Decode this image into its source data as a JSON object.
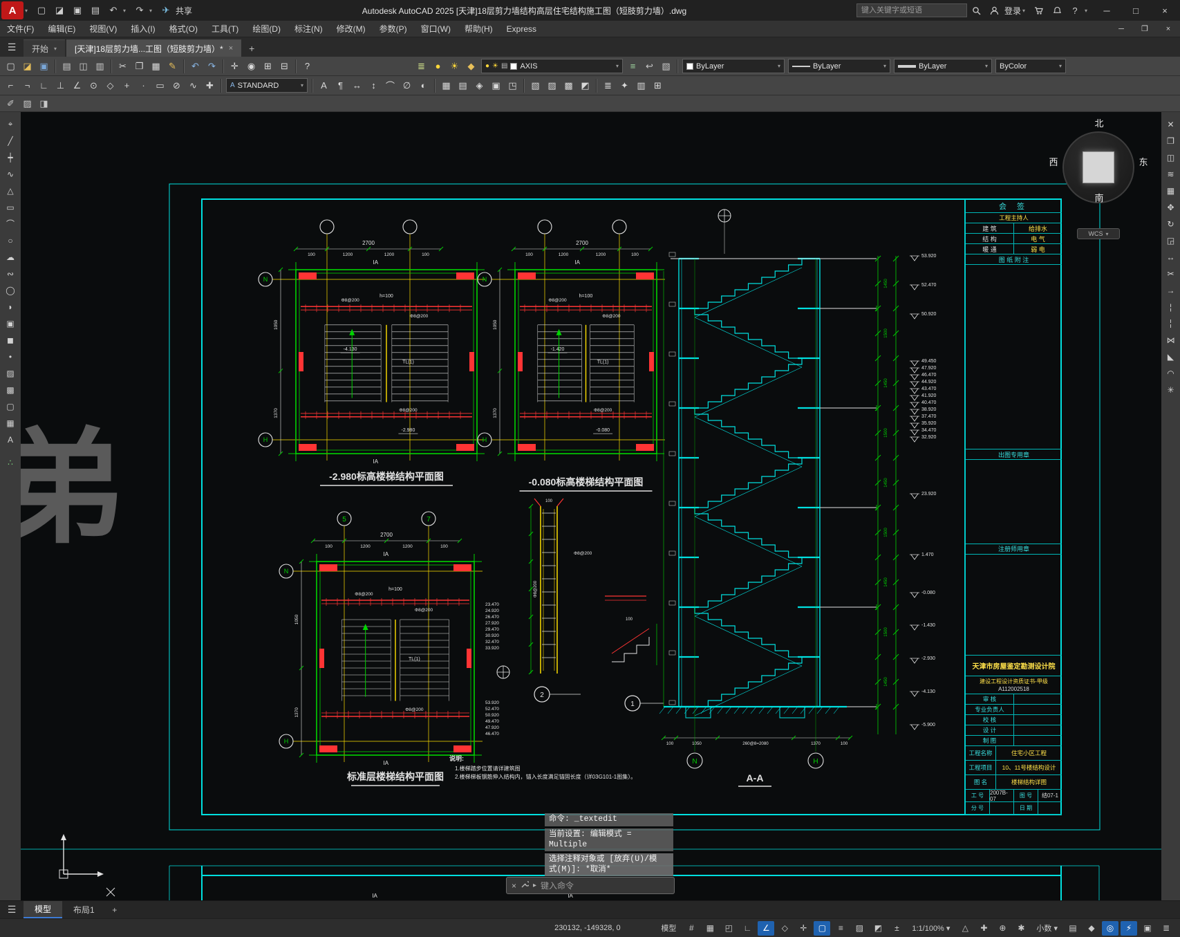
{
  "titlebar": {
    "app_logo": "A",
    "share": "共享",
    "title": "Autodesk AutoCAD 2025   [天津]18层剪力墙结构高层住宅结构施工图（短肢剪力墙）.dwg",
    "search_placeholder": "键入关键字或短语",
    "signin": "登录"
  },
  "menubar": {
    "items": [
      "文件(F)",
      "编辑(E)",
      "视图(V)",
      "插入(I)",
      "格式(O)",
      "工具(T)",
      "绘图(D)",
      "标注(N)",
      "修改(M)",
      "参数(P)",
      "窗口(W)",
      "帮助(H)",
      "Express"
    ]
  },
  "tabs": {
    "start": "开始",
    "document": "[天津]18层剪力墙...工图（短肢剪力墙）*"
  },
  "toolbar": {
    "layer_combo": "AXIS",
    "color_combo": "ByLayer",
    "linetype_combo": "ByLayer",
    "lineweight_combo": "ByLayer",
    "plotstyle_combo": "ByColor",
    "style_combo": "STANDARD",
    "row1": [
      {
        "n": "new-file",
        "g": "▢",
        "c": "#d9d9d9"
      },
      {
        "n": "open-file",
        "g": "◪",
        "c": "#e8c05a"
      },
      {
        "n": "save-file",
        "g": "▣",
        "c": "#7aa7d8"
      },
      {
        "n": "sep"
      },
      {
        "n": "plot",
        "g": "▤",
        "c": "#c9c9c9"
      },
      {
        "n": "plot-preview",
        "g": "◫",
        "c": "#c9c9c9"
      },
      {
        "n": "publish",
        "g": "▥",
        "c": "#c9c9c9"
      },
      {
        "n": "sep"
      },
      {
        "n": "cut-clip",
        "g": "✂",
        "c": "#d9d9d9"
      },
      {
        "n": "copy-clip",
        "g": "❐",
        "c": "#d9d9d9"
      },
      {
        "n": "paste-clip",
        "g": "▦",
        "c": "#d9d9d9"
      },
      {
        "n": "match-properties",
        "g": "✎",
        "c": "#e8c05a"
      },
      {
        "n": "sep"
      },
      {
        "n": "undo",
        "g": "↶",
        "c": "#8ab8e8"
      },
      {
        "n": "redo",
        "g": "↷",
        "c": "#8ab8e8"
      },
      {
        "n": "sep"
      },
      {
        "n": "pan",
        "g": "✛",
        "c": "#d9d9d9"
      },
      {
        "n": "zoom-realtime",
        "g": "◉",
        "c": "#d9d9d9"
      },
      {
        "n": "zoom-window",
        "g": "⊞",
        "c": "#d9d9d9"
      },
      {
        "n": "zoom-previous",
        "g": "⊟",
        "c": "#d9d9d9"
      },
      {
        "n": "sep"
      },
      {
        "n": "help",
        "g": "?",
        "c": "#d9d9d9"
      },
      {
        "n": "gap",
        "w": 140
      },
      {
        "n": "layer-properties",
        "g": "≣",
        "c": "#cfe08a"
      },
      {
        "n": "layer-on-off",
        "g": "●",
        "c": "#ffd83a"
      },
      {
        "n": "layer-freeze",
        "g": "☀",
        "c": "#ffd83a"
      },
      {
        "n": "layer-lock",
        "g": "◆",
        "c": "#e8c05a"
      },
      {
        "n": "combo-layer"
      },
      {
        "n": "make-current-layer",
        "g": "≡",
        "c": "#9fd49f"
      },
      {
        "n": "layer-previous",
        "g": "↩",
        "c": "#c9c9c9"
      },
      {
        "n": "layer-states",
        "g": "▧",
        "c": "#c9c9c9"
      },
      {
        "n": "sep"
      },
      {
        "n": "combo-color"
      },
      {
        "n": "combo-linetype"
      },
      {
        "n": "combo-lineweight"
      },
      {
        "n": "combo-plotstyle"
      }
    ],
    "row2": [
      {
        "n": "snap-from",
        "g": "⌐",
        "c": "#d2d2d2"
      },
      {
        "n": "snap-endpoint",
        "g": "¬",
        "c": "#d2d2d2"
      },
      {
        "n": "snap-midpoint",
        "g": "∟",
        "c": "#d2d2d2"
      },
      {
        "n": "snap-perpendicular",
        "g": "⊥",
        "c": "#d2d2d2"
      },
      {
        "n": "snap-intersection",
        "g": "∠",
        "c": "#d2d2d2"
      },
      {
        "n": "snap-center",
        "g": "⊙",
        "c": "#d2d2d2"
      },
      {
        "n": "snap-quadrant",
        "g": "◇",
        "c": "#d2d2d2"
      },
      {
        "n": "snap-node",
        "g": "+",
        "c": "#d2d2d2"
      },
      {
        "n": "snap-nearest",
        "g": "·",
        "c": "#d2d2d2"
      },
      {
        "n": "snap-extension",
        "g": "▭",
        "c": "#d2d2d2"
      },
      {
        "n": "snap-none",
        "g": "⊘",
        "c": "#d2d2d2"
      },
      {
        "n": "snap-tangent",
        "g": "∿",
        "c": "#d2d2d2"
      },
      {
        "n": "snap-parallel",
        "g": "✚",
        "c": "#d2d2d2"
      },
      {
        "n": "sep"
      },
      {
        "n": "combo-style"
      },
      {
        "n": "sep"
      },
      {
        "n": "multiline-text",
        "g": "A",
        "c": "#d9d9d9"
      },
      {
        "n": "single-line-text",
        "g": "¶",
        "c": "#d9d9d9"
      },
      {
        "n": "dim-linear",
        "g": "↔",
        "c": "#d9d9d9"
      },
      {
        "n": "dim-aligned",
        "g": "↕",
        "c": "#d9d9d9"
      },
      {
        "n": "dim-arc",
        "g": "⌒",
        "c": "#d9d9d9"
      },
      {
        "n": "dim-diameter",
        "g": "∅",
        "c": "#d9d9d9"
      },
      {
        "n": "dim-radius",
        "g": "◐",
        "c": "#d9d9d9"
      },
      {
        "n": "sep"
      },
      {
        "n": "table",
        "g": "▦",
        "c": "#d9d9d9"
      },
      {
        "n": "field",
        "g": "▤",
        "c": "#d9d9d9"
      },
      {
        "n": "block-editor",
        "g": "◈",
        "c": "#d9d9d9"
      },
      {
        "n": "insert-block",
        "g": "▣",
        "c": "#d9d9d9"
      },
      {
        "n": "attribute",
        "g": "◳",
        "c": "#d9d9d9"
      },
      {
        "n": "sep"
      },
      {
        "n": "external-reference",
        "g": "▧",
        "c": "#d9d9d9"
      },
      {
        "n": "image-attach",
        "g": "▨",
        "c": "#d9d9d9"
      },
      {
        "n": "hatch",
        "g": "▩",
        "c": "#d9d9d9"
      },
      {
        "n": "gradient",
        "g": "◩",
        "c": "#d9d9d9"
      },
      {
        "n": "sep"
      },
      {
        "n": "properties-palette",
        "g": "≣",
        "c": "#d9d9d9"
      },
      {
        "n": "design-center",
        "g": "✦",
        "c": "#d9d9d9"
      },
      {
        "n": "tool-palettes",
        "g": "▥",
        "c": "#d9d9d9"
      },
      {
        "n": "quick-calc",
        "g": "⊞",
        "c": "#d9d9d9"
      }
    ],
    "row3": [
      {
        "n": "in-place-text-edit",
        "g": "✐",
        "c": "#c9c9c9"
      },
      {
        "n": "image-adjust",
        "g": "▨",
        "c": "#c9c9c9"
      },
      {
        "n": "draw-order",
        "g": "◨",
        "c": "#c9c9c9"
      }
    ]
  },
  "left_toolbar": [
    {
      "n": "select-tool",
      "g": "⌖"
    },
    {
      "n": "line-tool",
      "g": "╱"
    },
    {
      "n": "construction-line-tool",
      "g": "┿"
    },
    {
      "n": "polyline-tool",
      "g": "∿"
    },
    {
      "n": "polygon-tool",
      "g": "△"
    },
    {
      "n": "rectangle-tool",
      "g": "▭"
    },
    {
      "n": "arc-tool",
      "g": "⌒"
    },
    {
      "n": "circle-tool",
      "g": "○"
    },
    {
      "n": "revision-cloud-tool",
      "g": "☁"
    },
    {
      "n": "spline-tool",
      "g": "∾"
    },
    {
      "n": "ellipse-tool",
      "g": "◯"
    },
    {
      "n": "ellipse-arc-tool",
      "g": "◗"
    },
    {
      "n": "insert-block-tool",
      "g": "▣"
    },
    {
      "n": "create-block-tool",
      "g": "◼"
    },
    {
      "n": "point-tool",
      "g": "•"
    },
    {
      "n": "hatch-tool",
      "g": "▨"
    },
    {
      "n": "gradient-tool",
      "g": "▩"
    },
    {
      "n": "region-tool",
      "g": "▢"
    },
    {
      "n": "table-tool",
      "g": "▦"
    },
    {
      "n": "text-tool",
      "g": "A"
    },
    {
      "n": "sep"
    },
    {
      "n": "point-style-tool",
      "g": "∴",
      "c": "#7fd47f"
    }
  ],
  "right_toolbar": [
    {
      "n": "erase-tool",
      "g": "✕"
    },
    {
      "n": "copy-tool",
      "g": "❐"
    },
    {
      "n": "mirror-tool",
      "g": "◫"
    },
    {
      "n": "offset-tool",
      "g": "≋"
    },
    {
      "n": "array-tool",
      "g": "▦"
    },
    {
      "n": "move-tool",
      "g": "✥"
    },
    {
      "n": "rotate-tool",
      "g": "↻"
    },
    {
      "n": "scale-tool",
      "g": "◲"
    },
    {
      "n": "stretch-tool",
      "g": "↔"
    },
    {
      "n": "trim-tool",
      "g": "✂"
    },
    {
      "n": "extend-tool",
      "g": "→"
    },
    {
      "n": "break-at-point-tool",
      "g": "¦"
    },
    {
      "n": "break-tool",
      "g": "╎"
    },
    {
      "n": "join-tool",
      "g": "⋈"
    },
    {
      "n": "chamfer-tool",
      "g": "◣"
    },
    {
      "n": "fillet-tool",
      "g": "◠"
    },
    {
      "n": "explode-tool",
      "g": "✳"
    }
  ],
  "drawing": {
    "plans": [
      {
        "title": "-2.980标高楼梯结构平面图",
        "grid_top": [
          "",
          ""
        ],
        "grid_left": [
          "N",
          "H"
        ],
        "dim_overall": "2700",
        "dim_segs": [
          "100",
          "1200",
          "1200",
          "100"
        ],
        "dim_left": [
          "1050",
          "1370"
        ],
        "slab": "h=100",
        "beam": "TL(1)",
        "rebar_top": "Φ8@200",
        "rebar_bot": "Φ8@200",
        "level_a": "-4.130",
        "level_b": "-2.980",
        "cut_label": "IA"
      },
      {
        "title": "-0.080标高楼梯结构平面图",
        "grid_top": [
          "",
          ""
        ],
        "grid_left": [
          "N",
          "H"
        ],
        "dim_overall": "2700",
        "dim_segs": [
          "100",
          "1200",
          "1200",
          "100"
        ],
        "dim_left": [
          "1050",
          "1370"
        ],
        "slab": "h=100",
        "beam": "TL(1)",
        "rebar_top": "Φ8@200",
        "rebar_bot": "Φ8@200",
        "level_a": "-1.420",
        "level_b": "-0.080",
        "cut_label": "IA"
      },
      {
        "title": "标准层楼梯结构平面图",
        "grid_top": [
          "5",
          "7"
        ],
        "grid_left": [
          "N",
          "H"
        ],
        "dim_overall": "2700",
        "dim_segs": [
          "100",
          "1200",
          "1200",
          "100"
        ],
        "dim_left": [
          "1050",
          "1370"
        ],
        "slab": "h=100",
        "beam": "TL(1)",
        "rebar_top": "Φ8@200",
        "rebar_bot": "Φ8@200",
        "level_a": "",
        "level_b": "",
        "cut_label": "IA",
        "elev_stack1": [
          "23.470",
          "24.920",
          "26.470",
          "27.920",
          "29.470",
          "30.920",
          "32.470",
          "33.920"
        ],
        "elev_stack2": [
          "53.920",
          "52.470",
          "50.920",
          "49.470",
          "47.920",
          "46.470"
        ]
      }
    ],
    "section": {
      "label": "A-A",
      "grid": [
        "N",
        "H"
      ],
      "elevations": [
        "53.920",
        "52.470",
        "50.920",
        "49.450",
        "47.920",
        "46.470",
        "44.920",
        "43.470",
        "41.920",
        "40.470",
        "38.920",
        "37.470",
        "35.920",
        "34.470",
        "32.920",
        "23.920",
        "1.470",
        "-0.080",
        "-1.430",
        "-2.930",
        "-4.130",
        "-5.900"
      ],
      "dim_chain": [
        "1450",
        "1500"
      ],
      "dim_bottom": [
        "100",
        "1050",
        "260@8=2080",
        "1370",
        "100"
      ]
    },
    "details": {
      "bubble1": "1",
      "bubble2": "2",
      "rebar": "Φ8@200",
      "dim100": "100"
    },
    "notes": {
      "title": "说明:",
      "line1": "1.楼梯踏步位置请详建筑图",
      "line2": "2.楼梯梯板钢筋伸入结构内，锚入长度满足锚固长度（详03G101-1图集）。"
    },
    "bigchar": "弟"
  },
  "titleblock": {
    "sign": "会  签",
    "pm_row": "工程主持人",
    "disciplines": [
      [
        "建 筑",
        "给排水"
      ],
      [
        "结 构",
        "电 气"
      ],
      [
        "暖 通",
        "弱 电"
      ]
    ],
    "notes_header": "图 纸 附 注",
    "stamp_out": "出图专用章",
    "stamp_reg": "注册师用章",
    "org": "天津市房屋鉴定勘测设计院",
    "cert": "建设工程设计资质证书-甲级",
    "cert_no": "A112002518",
    "review_rows": [
      "审  核",
      "专业负责人",
      "校  核",
      "设  计",
      "制  图"
    ],
    "project_rows": [
      [
        "工程名称",
        "住宅小区工程"
      ],
      [
        "工程项目",
        "10、11号楼结构设计"
      ],
      [
        "图  名",
        "楼梯结构详图"
      ]
    ],
    "footer_rows": [
      [
        "工  号",
        "2007B-07",
        "图  号",
        "结07-1"
      ],
      [
        "分  号",
        "",
        "日  期",
        ""
      ]
    ]
  },
  "compass": {
    "n": "北",
    "s": "南",
    "w": "西",
    "e": "东",
    "wcs": "WCS"
  },
  "command": {
    "history1": "命令: _textedit",
    "history2a": "当前设置: 编辑模式 =",
    "history2b": "Multiple",
    "history3a": "选择注释对象或 [放弃(U)/模",
    "history3b": "式(M)]: *取消*",
    "input_placeholder": "键入命令"
  },
  "modelrow": {
    "model_tab": "模型",
    "layout_tab": "布局1"
  },
  "statusbar": {
    "items": [
      {
        "k": "coords",
        "n": "coordinate-display",
        "label": "230132, -149328, 0"
      },
      {
        "k": "text",
        "n": "model-space-button",
        "label": "模型"
      },
      {
        "k": "icon",
        "n": "grid-display",
        "g": "#"
      },
      {
        "k": "icon",
        "n": "snap-mode",
        "g": "▦"
      },
      {
        "k": "icon",
        "n": "infer-constraints",
        "g": "◰"
      },
      {
        "k": "icon",
        "n": "ortho-mode",
        "g": "∟"
      },
      {
        "k": "icon",
        "n": "polar-tracking",
        "g": "∠",
        "a": true
      },
      {
        "k": "icon",
        "n": "isometric-drafting",
        "g": "◇"
      },
      {
        "k": "icon",
        "n": "object-snap-tracking",
        "g": "✛"
      },
      {
        "k": "icon",
        "n": "object-snap",
        "g": "▢",
        "a": true
      },
      {
        "k": "icon",
        "n": "show-lineweight",
        "g": "≡"
      },
      {
        "k": "icon",
        "n": "transparency",
        "g": "▨"
      },
      {
        "k": "icon",
        "n": "selection-cycling",
        "g": "◩"
      },
      {
        "k": "icon",
        "n": "dynamic-input",
        "g": "±"
      },
      {
        "k": "text",
        "n": "annotation-scale-button",
        "label": "1:1/100%",
        "chev": true
      },
      {
        "k": "icon",
        "n": "annotation-visibility",
        "g": "△"
      },
      {
        "k": "icon",
        "n": "annotation-auto-scale",
        "g": "✚"
      },
      {
        "k": "icon",
        "n": "annotation-monitor",
        "g": "⊕"
      },
      {
        "k": "icon",
        "n": "workspace-switching",
        "g": "✱"
      },
      {
        "k": "text",
        "n": "units-button",
        "label": "小数",
        "chev": true
      },
      {
        "k": "icon",
        "n": "quick-properties",
        "g": "▤"
      },
      {
        "k": "icon",
        "n": "lock-ui",
        "g": "◆"
      },
      {
        "k": "icon",
        "n": "object-isolate",
        "g": "◎",
        "a": true
      },
      {
        "k": "icon",
        "n": "graphics-performance",
        "g": "⚡",
        "a": true
      },
      {
        "k": "icon",
        "n": "clean-screen",
        "g": "▣"
      },
      {
        "k": "icon",
        "n": "customize",
        "g": "≣"
      }
    ]
  }
}
